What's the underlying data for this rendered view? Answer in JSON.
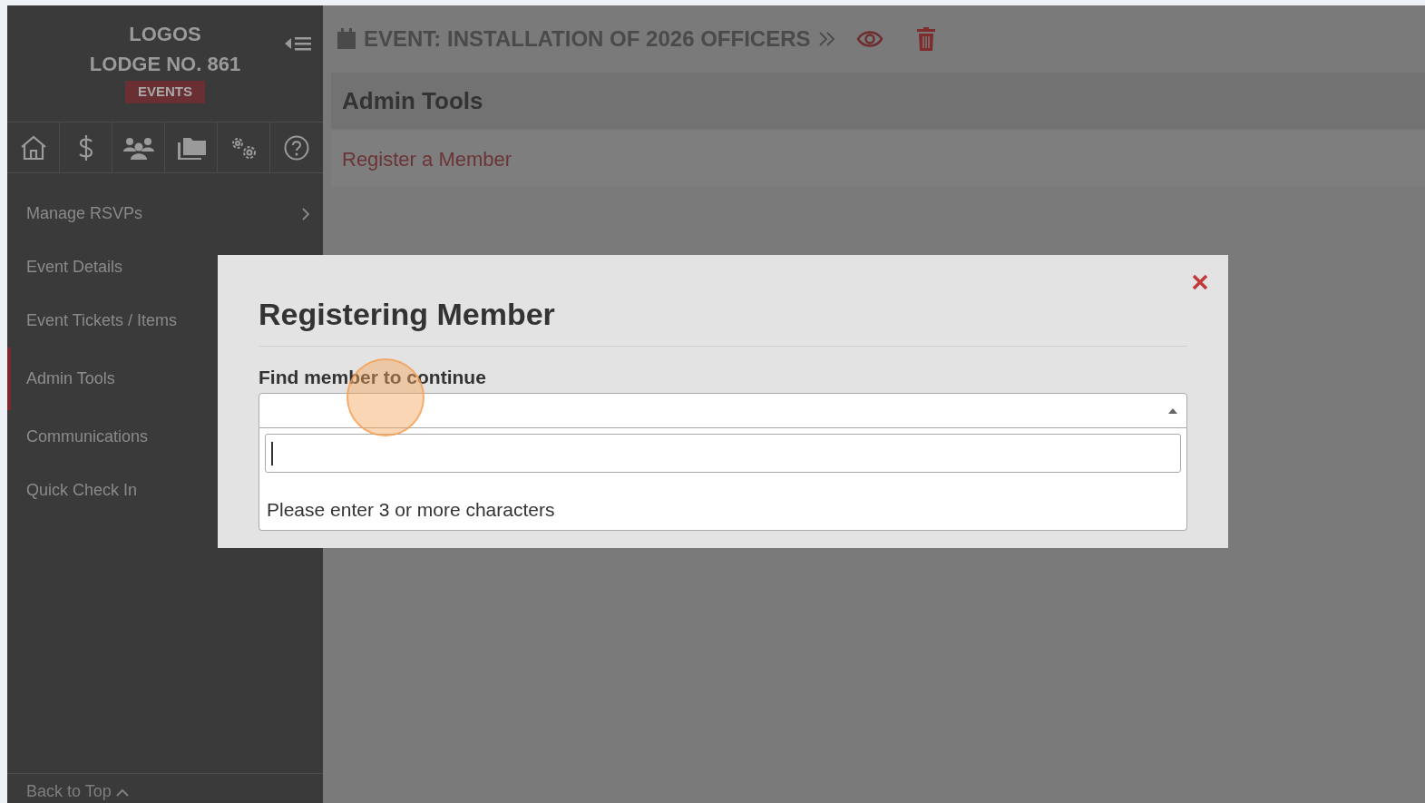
{
  "sidebar": {
    "org_lines": [
      "LOGOS",
      "LODGE NO. 861"
    ],
    "badge": "EVENTS",
    "nav_items": [
      {
        "label": "Manage RSVPs",
        "selected": false,
        "expandable": true
      },
      {
        "label": "Event Details",
        "selected": false
      },
      {
        "label": "Event Tickets / Items",
        "selected": false
      },
      {
        "label": "Admin Tools",
        "selected": true
      },
      {
        "label": "Communications",
        "selected": false
      },
      {
        "label": "Quick Check In",
        "selected": false
      }
    ],
    "back_to_top": "Back to Top"
  },
  "header": {
    "title": "EVENT: INSTALLATION OF 2026 OFFICERS"
  },
  "panel": {
    "title": "Admin Tools",
    "links": [
      "Register a Member"
    ]
  },
  "modal": {
    "title": "Registering Member",
    "field_label": "Find member to continue",
    "select": {
      "expanded": true,
      "message": "Please enter 3 or more characters"
    }
  }
}
